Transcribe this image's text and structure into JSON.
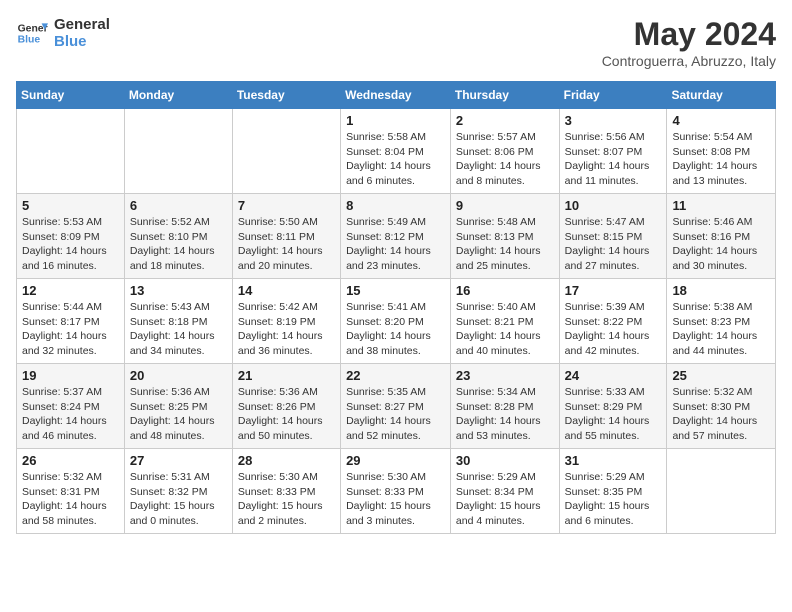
{
  "header": {
    "logo_line1": "General",
    "logo_line2": "Blue",
    "month_title": "May 2024",
    "location": "Controguerra, Abruzzo, Italy"
  },
  "weekdays": [
    "Sunday",
    "Monday",
    "Tuesday",
    "Wednesday",
    "Thursday",
    "Friday",
    "Saturday"
  ],
  "weeks": [
    [
      {
        "day": "",
        "info": ""
      },
      {
        "day": "",
        "info": ""
      },
      {
        "day": "",
        "info": ""
      },
      {
        "day": "1",
        "info": "Sunrise: 5:58 AM\nSunset: 8:04 PM\nDaylight: 14 hours\nand 6 minutes."
      },
      {
        "day": "2",
        "info": "Sunrise: 5:57 AM\nSunset: 8:06 PM\nDaylight: 14 hours\nand 8 minutes."
      },
      {
        "day": "3",
        "info": "Sunrise: 5:56 AM\nSunset: 8:07 PM\nDaylight: 14 hours\nand 11 minutes."
      },
      {
        "day": "4",
        "info": "Sunrise: 5:54 AM\nSunset: 8:08 PM\nDaylight: 14 hours\nand 13 minutes."
      }
    ],
    [
      {
        "day": "5",
        "info": "Sunrise: 5:53 AM\nSunset: 8:09 PM\nDaylight: 14 hours\nand 16 minutes."
      },
      {
        "day": "6",
        "info": "Sunrise: 5:52 AM\nSunset: 8:10 PM\nDaylight: 14 hours\nand 18 minutes."
      },
      {
        "day": "7",
        "info": "Sunrise: 5:50 AM\nSunset: 8:11 PM\nDaylight: 14 hours\nand 20 minutes."
      },
      {
        "day": "8",
        "info": "Sunrise: 5:49 AM\nSunset: 8:12 PM\nDaylight: 14 hours\nand 23 minutes."
      },
      {
        "day": "9",
        "info": "Sunrise: 5:48 AM\nSunset: 8:13 PM\nDaylight: 14 hours\nand 25 minutes."
      },
      {
        "day": "10",
        "info": "Sunrise: 5:47 AM\nSunset: 8:15 PM\nDaylight: 14 hours\nand 27 minutes."
      },
      {
        "day": "11",
        "info": "Sunrise: 5:46 AM\nSunset: 8:16 PM\nDaylight: 14 hours\nand 30 minutes."
      }
    ],
    [
      {
        "day": "12",
        "info": "Sunrise: 5:44 AM\nSunset: 8:17 PM\nDaylight: 14 hours\nand 32 minutes."
      },
      {
        "day": "13",
        "info": "Sunrise: 5:43 AM\nSunset: 8:18 PM\nDaylight: 14 hours\nand 34 minutes."
      },
      {
        "day": "14",
        "info": "Sunrise: 5:42 AM\nSunset: 8:19 PM\nDaylight: 14 hours\nand 36 minutes."
      },
      {
        "day": "15",
        "info": "Sunrise: 5:41 AM\nSunset: 8:20 PM\nDaylight: 14 hours\nand 38 minutes."
      },
      {
        "day": "16",
        "info": "Sunrise: 5:40 AM\nSunset: 8:21 PM\nDaylight: 14 hours\nand 40 minutes."
      },
      {
        "day": "17",
        "info": "Sunrise: 5:39 AM\nSunset: 8:22 PM\nDaylight: 14 hours\nand 42 minutes."
      },
      {
        "day": "18",
        "info": "Sunrise: 5:38 AM\nSunset: 8:23 PM\nDaylight: 14 hours\nand 44 minutes."
      }
    ],
    [
      {
        "day": "19",
        "info": "Sunrise: 5:37 AM\nSunset: 8:24 PM\nDaylight: 14 hours\nand 46 minutes."
      },
      {
        "day": "20",
        "info": "Sunrise: 5:36 AM\nSunset: 8:25 PM\nDaylight: 14 hours\nand 48 minutes."
      },
      {
        "day": "21",
        "info": "Sunrise: 5:36 AM\nSunset: 8:26 PM\nDaylight: 14 hours\nand 50 minutes."
      },
      {
        "day": "22",
        "info": "Sunrise: 5:35 AM\nSunset: 8:27 PM\nDaylight: 14 hours\nand 52 minutes."
      },
      {
        "day": "23",
        "info": "Sunrise: 5:34 AM\nSunset: 8:28 PM\nDaylight: 14 hours\nand 53 minutes."
      },
      {
        "day": "24",
        "info": "Sunrise: 5:33 AM\nSunset: 8:29 PM\nDaylight: 14 hours\nand 55 minutes."
      },
      {
        "day": "25",
        "info": "Sunrise: 5:32 AM\nSunset: 8:30 PM\nDaylight: 14 hours\nand 57 minutes."
      }
    ],
    [
      {
        "day": "26",
        "info": "Sunrise: 5:32 AM\nSunset: 8:31 PM\nDaylight: 14 hours\nand 58 minutes."
      },
      {
        "day": "27",
        "info": "Sunrise: 5:31 AM\nSunset: 8:32 PM\nDaylight: 15 hours\nand 0 minutes."
      },
      {
        "day": "28",
        "info": "Sunrise: 5:30 AM\nSunset: 8:33 PM\nDaylight: 15 hours\nand 2 minutes."
      },
      {
        "day": "29",
        "info": "Sunrise: 5:30 AM\nSunset: 8:33 PM\nDaylight: 15 hours\nand 3 minutes."
      },
      {
        "day": "30",
        "info": "Sunrise: 5:29 AM\nSunset: 8:34 PM\nDaylight: 15 hours\nand 4 minutes."
      },
      {
        "day": "31",
        "info": "Sunrise: 5:29 AM\nSunset: 8:35 PM\nDaylight: 15 hours\nand 6 minutes."
      },
      {
        "day": "",
        "info": ""
      }
    ]
  ]
}
